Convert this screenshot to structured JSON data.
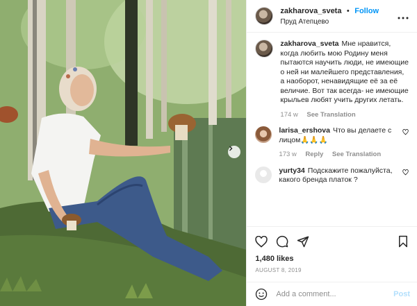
{
  "header": {
    "username": "zakharova_sveta",
    "separator": "•",
    "follow_label": "Follow",
    "location": "Пруд Атепцево",
    "more_icon": "more-horizontal-icon"
  },
  "photo": {
    "next_icon": "chevron-right-icon"
  },
  "comments": [
    {
      "username": "zakharova_sveta",
      "text": "Мне нравится, когда любить мою Родину меня пытаются научить люди, не имеющие о ней ни малейшего представления, а наоборот, ненавидящие её за её величие. Вот так всегда- не имеющие крыльев любят учить других летать.",
      "age": "174 w",
      "translation": "See Translation"
    },
    {
      "username": "larisa_ershova",
      "text": "Что вы делаете с лицом🙏🙏🙏",
      "age": "173 w",
      "reply": "Reply",
      "translation": "See Translation"
    },
    {
      "username": "yurty34",
      "text": "Подскажите пожалуйста, какого бренда платок ?"
    }
  ],
  "actions": {
    "icons": [
      "heart-icon",
      "comment-icon",
      "share-icon",
      "save-icon"
    ],
    "likes": "1,480 likes",
    "date": "AUGUST 8, 2019"
  },
  "add_comment": {
    "placeholder": "Add a comment...",
    "post_label": "Post",
    "emoji_icon": "emoji-icon"
  },
  "colors": {
    "accent": "#0095f6",
    "post_disabled": "#b2dffc",
    "meta": "#8e8e8e",
    "text": "#262626"
  }
}
